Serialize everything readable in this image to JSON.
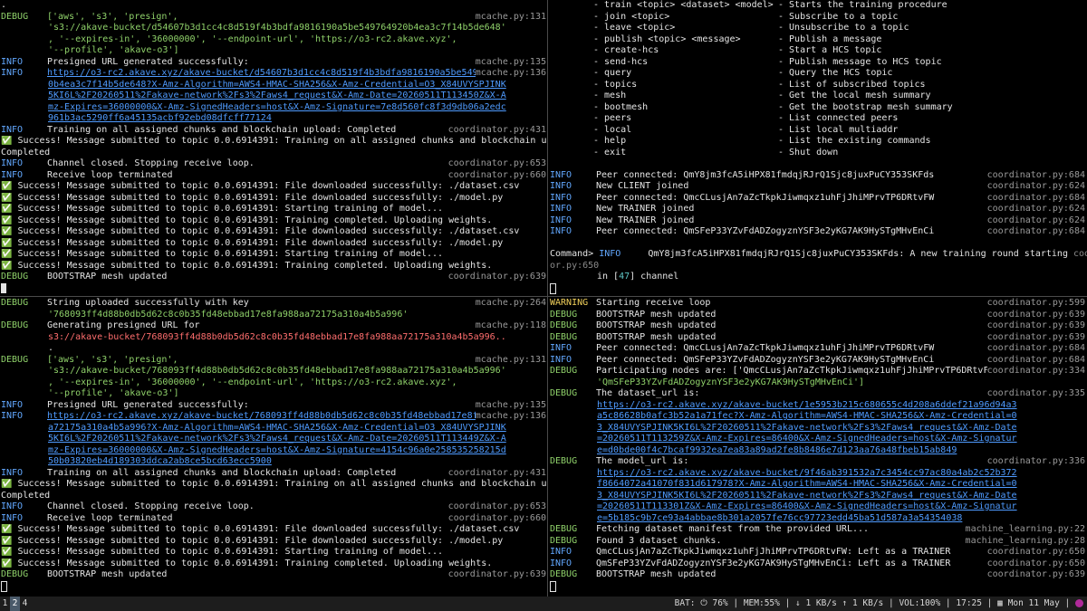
{
  "pane_tl": [
    {
      "lvl": "",
      "txt": ".",
      "src": ""
    },
    {
      "lvl": "DEBUG",
      "txt": "['aws', 's3', 'presign',",
      "src": "mcache.py:131",
      "cls": "str"
    },
    {
      "lvl": "",
      "txt": "'s3://akave-bucket/d54607b3d1cc4c8d519f4b3bdfa9816190a5be549764920b4ea3c7f14b5de648'",
      "src": "",
      "cls": "str ind"
    },
    {
      "lvl": "",
      "txt": ", '--expires-in', '36000000', '--endpoint-url', 'https://o3-rc2.akave.xyz',",
      "src": "",
      "cls": "str ind"
    },
    {
      "lvl": "",
      "txt": "'--profile', 'akave-o3']",
      "src": "",
      "cls": "str ind"
    },
    {
      "lvl": "INFO",
      "txt": "Presigned URL generated successfully:",
      "src": "mcache.py:135"
    },
    {
      "lvl": "INFO",
      "txt": "https://o3-rc2.akave.xyz/akave-bucket/d54607b3d1cc4c8d519f4b3bdfa9816190a5be54976492",
      "src": "mcache.py:136",
      "cls": "url"
    },
    {
      "lvl": "",
      "txt": "0b4ea3c7f14b5de648?X-Amz-Algorithm=AWS4-HMAC-SHA256&X-Amz-Credential=O3_X84UVYSPJINK",
      "src": "",
      "cls": "url ind"
    },
    {
      "lvl": "",
      "txt": "5KI6L%2F20260511%2Fakave-network%2Fs3%2Faws4_request&X-Amz-Date=20260511T113450Z&X-A",
      "src": "",
      "cls": "url ind"
    },
    {
      "lvl": "",
      "txt": "mz-Expires=36000000&X-Amz-SignedHeaders=host&X-Amz-Signature=7e8d560fc8f3d9db06a2edc",
      "src": "",
      "cls": "url ind"
    },
    {
      "lvl": "",
      "txt": "961b3ac5290ff6a45135acbf92ebd08dfcff77124",
      "src": "",
      "cls": "url ind"
    },
    {
      "lvl": "INFO",
      "txt": "Training on all assigned chunks and blockchain upload: Completed",
      "src": "coordinator.py:431"
    },
    {
      "lvl": "",
      "txt": "✅ Success! Message submitted to topic 0.0.6914391: Training on all assigned chunks and blockchain upload:",
      "src": ""
    },
    {
      "lvl": "",
      "txt": "Completed",
      "src": ""
    },
    {
      "lvl": "INFO",
      "txt": "Channel closed. Stopping receive loop.",
      "src": "coordinator.py:653"
    },
    {
      "lvl": "INFO",
      "txt": "Receive loop terminated",
      "src": "coordinator.py:660"
    },
    {
      "lvl": "",
      "txt": "✅ Success! Message submitted to topic 0.0.6914391: File downloaded successfully: ./dataset.csv",
      "src": ""
    },
    {
      "lvl": "",
      "txt": "✅ Success! Message submitted to topic 0.0.6914391: File downloaded successfully: ./model.py",
      "src": ""
    },
    {
      "lvl": "",
      "txt": "✅ Success! Message submitted to topic 0.0.6914391: Starting training of model...",
      "src": ""
    },
    {
      "lvl": "",
      "txt": "✅ Success! Message submitted to topic 0.0.6914391: Training completed. Uploading weights.",
      "src": ""
    },
    {
      "lvl": "",
      "txt": "✅ Success! Message submitted to topic 0.0.6914391: File downloaded successfully: ./dataset.csv",
      "src": ""
    },
    {
      "lvl": "",
      "txt": "✅ Success! Message submitted to topic 0.0.6914391: File downloaded successfully: ./model.py",
      "src": ""
    },
    {
      "lvl": "",
      "txt": "✅ Success! Message submitted to topic 0.0.6914391: Starting training of model...",
      "src": ""
    },
    {
      "lvl": "",
      "txt": "✅ Success! Message submitted to topic 0.0.6914391: Training completed. Uploading weights.",
      "src": ""
    },
    {
      "lvl": "DEBUG",
      "txt": "BOOTSTRAP mesh updated",
      "src": "coordinator.py:639"
    }
  ],
  "pane_tr_help": [
    [
      "- train <topic> <dataset> <model>",
      "- Starts the training procedure"
    ],
    [
      "- join <topic>",
      "- Subscribe to a topic"
    ],
    [
      "- leave <topic>",
      "- Unsubscribe to a topic"
    ],
    [
      "- publish <topic> <message>",
      "- Publish a message"
    ],
    [
      "- create-hcs",
      "- Start a HCS topic"
    ],
    [
      "- send-hcs",
      "- Publish message to HCS topic"
    ],
    [
      "- query",
      "- Query the HCS topic"
    ],
    [
      "- topics",
      "- List of subscribed topics"
    ],
    [
      "- mesh",
      "- Get the local mesh summary"
    ],
    [
      "- bootmesh",
      "- Get the bootstrap mesh summary"
    ],
    [
      "- peers",
      "- List connected peers"
    ],
    [
      "- local",
      "- List local multiaddr"
    ],
    [
      "- help",
      "- List the existing commands"
    ],
    [
      "- exit",
      "- Shut down"
    ]
  ],
  "pane_tr_log": [
    {
      "lvl": "INFO",
      "txt": "Peer connected: QmY8jm3fcA5iHPX81fmdqjRJrQ1Sjc8juxPuCY353SKFds",
      "src": "coordinator.py:684"
    },
    {
      "lvl": "INFO",
      "txt": "New CLIENT joined",
      "src": "coordinator.py:624"
    },
    {
      "lvl": "INFO",
      "txt": "Peer connected: QmcCLusjAn7aZcTkpkJiwmqxz1uhFjJhiMPrvTP6DRtvFW",
      "src": "coordinator.py:684"
    },
    {
      "lvl": "INFO",
      "txt": "New TRAINER joined",
      "src": "coordinator.py:624"
    },
    {
      "lvl": "INFO",
      "txt": "New TRAINER joined",
      "src": "coordinator.py:624"
    },
    {
      "lvl": "INFO",
      "txt": "Peer connected: QmSFeP33YZvFdADZogyznYSF3e2yKG7AK9HySTgMHvEnCi",
      "src": "coordinator.py:684"
    }
  ],
  "pane_tr_prompt": {
    "prefix": "Command> ",
    "lvl": "INFO",
    "txt": "     QmY8jm3fcA5iHPX81fmdqjRJrQ1Sjc8juxPuCY353SKFds: A new training round starting",
    "tail": " coordinat",
    "wrap": "or.py:650",
    "line2_pre": "in [",
    "channel_num": "47",
    "line2_post": "] channel"
  },
  "pane_bl": [
    {
      "lvl": "DEBUG",
      "txt": "String uploaded successfully with key",
      "src": "mcache.py:264"
    },
    {
      "lvl": "",
      "txt": "'768093ff4d88b0db5d62c8c0b35fd48ebbad17e8fa988aa72175a310a4b5a996'",
      "src": "",
      "cls": "str ind"
    },
    {
      "lvl": "DEBUG",
      "txt": "Generating presigned URL for",
      "src": "mcache.py:118"
    },
    {
      "lvl": "",
      "txt": "s3://akave-bucket/768093ff4d88b0db5d62c8c0b35fd48ebbad17e8fa988aa72175a310a4b5a996..",
      "src": "",
      "cls": "red ind"
    },
    {
      "lvl": "",
      "txt": ".",
      "src": "",
      "cls": "ind"
    },
    {
      "lvl": "DEBUG",
      "txt": "['aws', 's3', 'presign',",
      "src": "mcache.py:131",
      "cls": "str"
    },
    {
      "lvl": "",
      "txt": "'s3://akave-bucket/768093ff4d88b0db5d62c8c0b35fd48ebbad17e8fa988aa72175a310a4b5a996'",
      "src": "",
      "cls": "str ind"
    },
    {
      "lvl": "",
      "txt": ", '--expires-in', '36000000', '--endpoint-url', 'https://o3-rc2.akave.xyz',",
      "src": "",
      "cls": "str ind"
    },
    {
      "lvl": "",
      "txt": "'--profile', 'akave-o3']",
      "src": "",
      "cls": "str ind"
    },
    {
      "lvl": "INFO",
      "txt": "Presigned URL generated successfully:",
      "src": "mcache.py:135"
    },
    {
      "lvl": "INFO",
      "txt": "https://o3-rc2.akave.xyz/akave-bucket/768093ff4d88b0db5d62c8c0b35fd48ebbad17e8fa988a",
      "src": "mcache.py:136",
      "cls": "url"
    },
    {
      "lvl": "",
      "txt": "a72175a310a4b5a996?X-Amz-Algorithm=AWS4-HMAC-SHA256&X-Amz-Credential=O3_X84UVYSPJINK",
      "src": "",
      "cls": "url ind"
    },
    {
      "lvl": "",
      "txt": "5KI6L%2F20260511%2Fakave-network%2Fs3%2Faws4_request&X-Amz-Date=20260511T113449Z&X-A",
      "src": "",
      "cls": "url ind"
    },
    {
      "lvl": "",
      "txt": "mz-Expires=36000000&X-Amz-SignedHeaders=host&X-Amz-Signature=4154c96a0e258535258215d",
      "src": "",
      "cls": "url ind"
    },
    {
      "lvl": "",
      "txt": "50b03820eb4d189303ddca2ab8ce5bcd63ecc5900",
      "src": "",
      "cls": "url ind"
    },
    {
      "lvl": "INFO",
      "txt": "Training on all assigned chunks and blockchain upload: Completed",
      "src": "coordinator.py:431"
    },
    {
      "lvl": "",
      "txt": "✅ Success! Message submitted to topic 0.0.6914391: Training on all assigned chunks and blockchain upload:",
      "src": ""
    },
    {
      "lvl": "",
      "txt": "Completed",
      "src": ""
    },
    {
      "lvl": "INFO",
      "txt": "Channel closed. Stopping receive loop.",
      "src": "coordinator.py:653"
    },
    {
      "lvl": "INFO",
      "txt": "Receive loop terminated",
      "src": "coordinator.py:660"
    },
    {
      "lvl": "",
      "txt": "✅ Success! Message submitted to topic 0.0.6914391: File downloaded successfully: ./dataset.csv",
      "src": ""
    },
    {
      "lvl": "",
      "txt": "✅ Success! Message submitted to topic 0.0.6914391: File downloaded successfully: ./model.py",
      "src": ""
    },
    {
      "lvl": "",
      "txt": "✅ Success! Message submitted to topic 0.0.6914391: Starting training of model...",
      "src": ""
    },
    {
      "lvl": "",
      "txt": "✅ Success! Message submitted to topic 0.0.6914391: Training completed. Uploading weights.",
      "src": ""
    },
    {
      "lvl": "DEBUG",
      "txt": "BOOTSTRAP mesh updated",
      "src": "coordinator.py:639"
    }
  ],
  "pane_br": [
    {
      "lvl": "WARNING",
      "txt": "Starting receive loop",
      "src": "coordinator.py:599"
    },
    {
      "lvl": "DEBUG",
      "txt": "BOOTSTRAP mesh updated",
      "src": "coordinator.py:639"
    },
    {
      "lvl": "DEBUG",
      "txt": "BOOTSTRAP mesh updated",
      "src": "coordinator.py:639"
    },
    {
      "lvl": "DEBUG",
      "txt": "BOOTSTRAP mesh updated",
      "src": "coordinator.py:639"
    },
    {
      "lvl": "INFO",
      "txt": "Peer connected: QmcCLusjAn7aZcTkpkJiwmqxz1uhFjJhiMPrvTP6DRtvFW",
      "src": "coordinator.py:684"
    },
    {
      "lvl": "INFO",
      "txt": "Peer connected: QmSFeP33YZvFdADZogyznYSF3e2yKG7AK9HySTgMHvEnCi",
      "src": "coordinator.py:684"
    },
    {
      "lvl": "DEBUG",
      "txt": "Participating nodes are: ['QmcCLusjAn7aZcTkpkJiwmqxz1uhFjJhiMPrvTP6DRtvFW',",
      "src": "coordinator.py:334"
    },
    {
      "lvl": "",
      "txt": "'QmSFeP33YZvFdADZogyznYSF3e2yKG7AK9HySTgMHvEnCi']",
      "src": "",
      "cls": "str ind"
    },
    {
      "lvl": "DEBUG",
      "txt": "The dataset_url is:",
      "src": "coordinator.py:335"
    },
    {
      "lvl": "",
      "txt": "https://o3-rc2.akave.xyz/akave-bucket/1e5953b215c680655c4d208a6ddef21a96d94a3",
      "src": "",
      "cls": "url ind"
    },
    {
      "lvl": "",
      "txt": "a5c86628b0afc3b52a1a71fec?X-Amz-Algorithm=AWS4-HMAC-SHA256&X-Amz-Credential=0",
      "src": "",
      "cls": "url ind"
    },
    {
      "lvl": "",
      "txt": "3_X84UVYSPJINK5KI6L%2F20260511%2Fakave-network%2Fs3%2Faws4_request&X-Amz-Date",
      "src": "",
      "cls": "url ind"
    },
    {
      "lvl": "",
      "txt": "=20260511T113259Z&X-Amz-Expires=86400&X-Amz-SignedHeaders=host&X-Amz-Signatur",
      "src": "",
      "cls": "url ind"
    },
    {
      "lvl": "",
      "txt": "e=d0bde00f4c7bcaf9932ea7ea83a89ad2fe8b8486e7d123aa76a48fbeb15ab849",
      "src": "",
      "cls": "url ind"
    },
    {
      "lvl": "DEBUG",
      "txt": "The model_url is:",
      "src": "coordinator.py:336"
    },
    {
      "lvl": "",
      "txt": "https://o3-rc2.akave.xyz/akave-bucket/9f46ab391532a7c3454cc97ac80a4ab2c52b372",
      "src": "",
      "cls": "url ind"
    },
    {
      "lvl": "",
      "txt": "f8664072a41070f831d617978?X-Amz-Algorithm=AWS4-HMAC-SHA256&X-Amz-Credential=0",
      "src": "",
      "cls": "url ind"
    },
    {
      "lvl": "",
      "txt": "3_X84UVYSPJINK5KI6L%2F20260511%2Fakave-network%2Fs3%2Faws4_request&X-Amz-Date",
      "src": "",
      "cls": "url ind"
    },
    {
      "lvl": "",
      "txt": "=20260511T113301Z&X-Amz-Expires=86400&X-Amz-SignedHeaders=host&X-Amz-Signatur",
      "src": "",
      "cls": "url ind"
    },
    {
      "lvl": "",
      "txt": "e=5b185c9b7ce93a4abbae8b301a2057fe76cc97723edd45ba51d587a3a54354038",
      "src": "",
      "cls": "url ind"
    },
    {
      "lvl": "DEBUG",
      "txt": "Fetching dataset manifest from the provided URL...",
      "src": "machine_learning.py:22"
    },
    {
      "lvl": "DEBUG",
      "txt": "Found 3 dataset chunks.",
      "src": "machine_learning.py:28"
    },
    {
      "lvl": "INFO",
      "txt": "QmcCLusjAn7aZcTkpkJiwmqxz1uhFjJhiMPrvTP6DRtvFW: Left as a TRAINER",
      "src": "coordinator.py:650"
    },
    {
      "lvl": "INFO",
      "txt": "QmSFeP33YZvFdADZogyznYSF3e2yKG7AK9HySTgMHvEnCi: Left as a TRAINER",
      "src": "coordinator.py:650"
    },
    {
      "lvl": "DEBUG",
      "txt": "BOOTSTRAP mesh updated",
      "src": "coordinator.py:639"
    }
  ],
  "statusbar": {
    "workspaces": [
      "1",
      "2",
      "4"
    ],
    "active_workspace": "2",
    "battery": "BAT: ⏻ 76%",
    "memory": "MEM:55%",
    "network": "↓ 1 KB/s ↑ 1 KB/s",
    "volume": "VOL:100%",
    "time": "17:25",
    "date": "Mon 11 May",
    "calendar_icon": "calendar-icon",
    "tray_icon": "tray-app-icon"
  },
  "colors": {
    "debug": "#8fd16a",
    "info": "#62a8ff",
    "warning": "#f1d05b",
    "url": "#4f9bff",
    "path_red": "#ff6e6e",
    "source": "#9a9a9a",
    "statusbar_bg": "#1d1d1d"
  }
}
